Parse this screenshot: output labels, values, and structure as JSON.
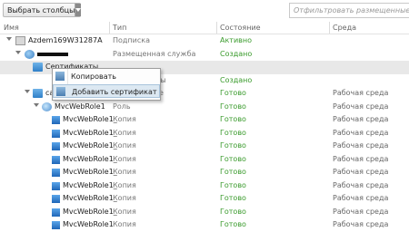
{
  "toolbar": {
    "columns_button": "Выбрать столбцы",
    "filter_placeholder": "Отфильтровать размещенные службы"
  },
  "columns": {
    "name": "Имя",
    "type": "Тип",
    "state": "Состояние",
    "env": "Среда"
  },
  "rows": [
    {
      "name": "Azdem169W31287A",
      "type": "Подписка",
      "state": "Активно",
      "env": ""
    },
    {
      "name": "",
      "type": "Размещенная служба",
      "state": "Создано",
      "env": ""
    },
    {
      "name": "Сертификаты",
      "type": "",
      "state": "",
      "env": ""
    },
    {
      "name": "",
      "type": "службы",
      "state": "Создано",
      "env": ""
    },
    {
      "name": "ca",
      "type": "е",
      "state": "Готово",
      "env": "Рабочая среда"
    },
    {
      "name": "MvcWebRole1",
      "type": "Роль",
      "state": "Готово",
      "env": "Рабочая среда"
    },
    {
      "name": "MvcWebRole1_",
      "type": "Копия",
      "state": "Готово",
      "env": "Рабочая среда"
    },
    {
      "name": "MvcWebRole1_",
      "type": "Копия",
      "state": "Готово",
      "env": "Рабочая среда"
    },
    {
      "name": "MvcWebRole1_",
      "type": "Копия",
      "state": "Готово",
      "env": "Рабочая среда"
    },
    {
      "name": "MvcWebRole1_",
      "type": "Копия",
      "state": "Готово",
      "env": "Рабочая среда"
    },
    {
      "name": "MvcWebRole1_",
      "type": "Копия",
      "state": "Готово",
      "env": "Рабочая среда"
    },
    {
      "name": "MvcWebRole1_",
      "type": "Копия",
      "state": "Готово",
      "env": "Рабочая среда"
    },
    {
      "name": "MvcWebRole1_",
      "type": "Копия",
      "state": "Готово",
      "env": "Рабочая среда"
    },
    {
      "name": "MvcWebRole1_",
      "type": "Копия",
      "state": "Готово",
      "env": "Рабочая среда"
    },
    {
      "name": "MvcWebRole1",
      "type": "Копия",
      "state": "Готово",
      "env": "Рабочая среда"
    }
  ],
  "context_menu": {
    "copy": "Копировать",
    "add_certificate": "Добавить сертификат"
  }
}
